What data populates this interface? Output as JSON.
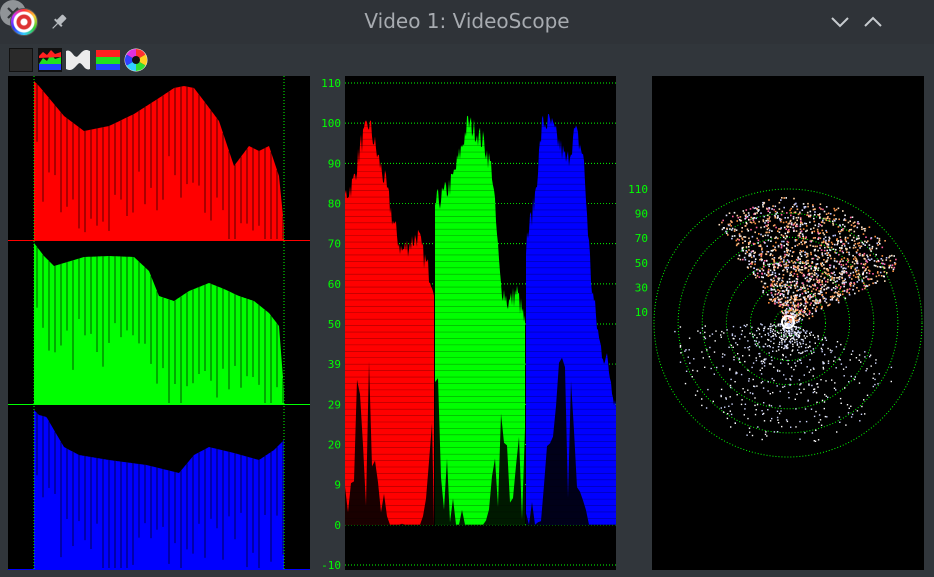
{
  "window": {
    "title": "Video 1: VideoScope"
  },
  "icons": {
    "app": "videoscope-app-icon",
    "pin": "pin-icon",
    "minimize": "chevron-down-icon",
    "maximize": "chevron-up-icon",
    "close": "close-icon"
  },
  "toolbar": {
    "tools": [
      "grayscale-toggle-icon",
      "histogram-icon",
      "waveform-icon",
      "rgb-parade-icon",
      "vectorscope-icon"
    ]
  },
  "colors": {
    "background": "#31363b",
    "titlebar": "#2f3338",
    "scope_bg": "#000000",
    "grid": "#00ff00",
    "red": "#ff0000",
    "green": "#00ff00",
    "blue": "#0000ff"
  },
  "waveform": {
    "axis_labels": [
      "110",
      "100",
      "90",
      "80",
      "70",
      "60",
      "50",
      "39",
      "29",
      "20",
      "9",
      "0",
      "-10"
    ]
  },
  "vectorscope": {
    "ring_labels": [
      "110",
      "90",
      "70",
      "50",
      "30",
      "10"
    ]
  }
}
